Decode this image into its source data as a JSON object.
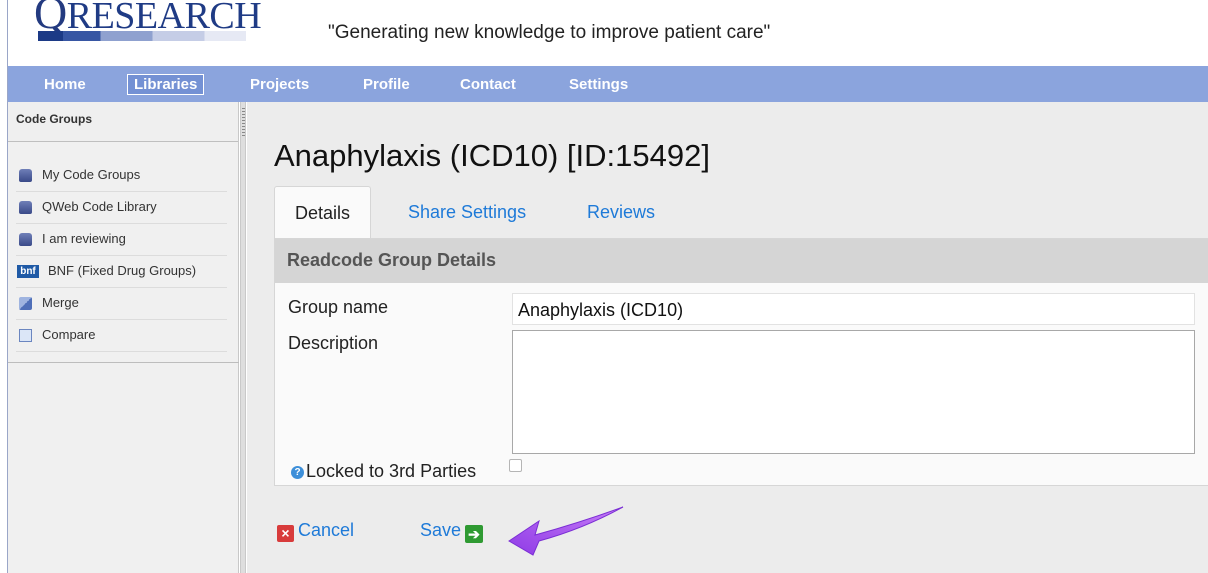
{
  "header": {
    "logo_q": "Q",
    "logo_text": "RESEARCH",
    "tagline": "\"Generating new knowledge to improve patient care\""
  },
  "nav": {
    "items": [
      "Home",
      "Libraries",
      "Projects",
      "Profile",
      "Contact",
      "Settings"
    ],
    "active": "Libraries"
  },
  "sidebar": {
    "title": "Code Groups",
    "items": [
      {
        "label": "My Code Groups",
        "icon": "database-icon"
      },
      {
        "label": "QWeb Code Library",
        "icon": "database-icon"
      },
      {
        "label": "I am reviewing",
        "icon": "database-icon"
      },
      {
        "label": "BNF (Fixed Drug Groups)",
        "icon": "bnf-icon",
        "icon_text": "bnf"
      },
      {
        "label": "Merge",
        "icon": "merge-icon"
      },
      {
        "label": "Compare",
        "icon": "compare-icon"
      }
    ]
  },
  "main": {
    "title": "Anaphylaxis (ICD10) [ID:15492]",
    "tabs": [
      "Details",
      "Share Settings",
      "Reviews"
    ],
    "active_tab": "Details",
    "panel": {
      "heading": "Readcode Group Details",
      "group_name_label": "Group name",
      "group_name_value": "Anaphylaxis (ICD10)",
      "description_label": "Description",
      "description_value": "",
      "locked_label": "Locked to 3rd Parties",
      "locked_checked": false
    },
    "actions": {
      "cancel_label": "Cancel",
      "save_label": "Save"
    }
  },
  "colors": {
    "nav_bg": "#8ba4dd",
    "link": "#1e7ad8",
    "annotation_arrow": "#a64ef0"
  }
}
